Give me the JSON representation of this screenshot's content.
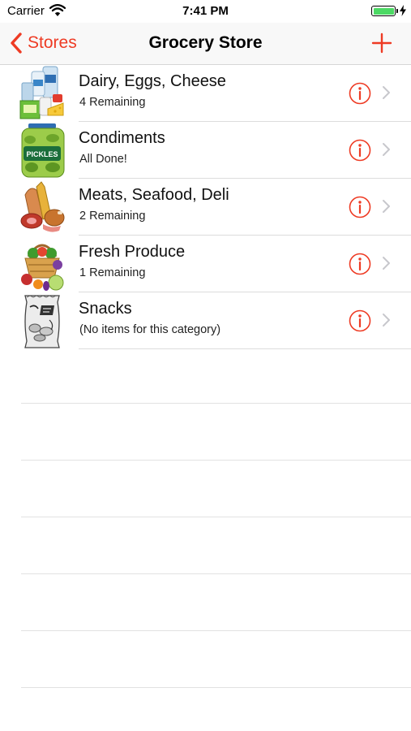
{
  "status_bar": {
    "carrier": "Carrier",
    "time": "7:41 PM",
    "battery_icon": "battery-full-icon",
    "battery_color": "#4cd964"
  },
  "nav": {
    "back_label": "Stores",
    "title": "Grocery Store",
    "add_icon": "plus-icon",
    "accent_color": "#ee3b24"
  },
  "categories": [
    {
      "name": "Dairy, Eggs, Cheese",
      "status": "4 Remaining",
      "icon": "dairy-icon"
    },
    {
      "name": "Condiments",
      "status": "All Done!",
      "icon": "pickles-jar-icon"
    },
    {
      "name": "Meats, Seafood, Deli",
      "status": "2 Remaining",
      "icon": "meats-icon"
    },
    {
      "name": "Fresh Produce",
      "status": "1 Remaining",
      "icon": "produce-basket-icon"
    },
    {
      "name": "Snacks",
      "status": "(No items for this category)",
      "icon": "chips-bag-icon"
    }
  ]
}
